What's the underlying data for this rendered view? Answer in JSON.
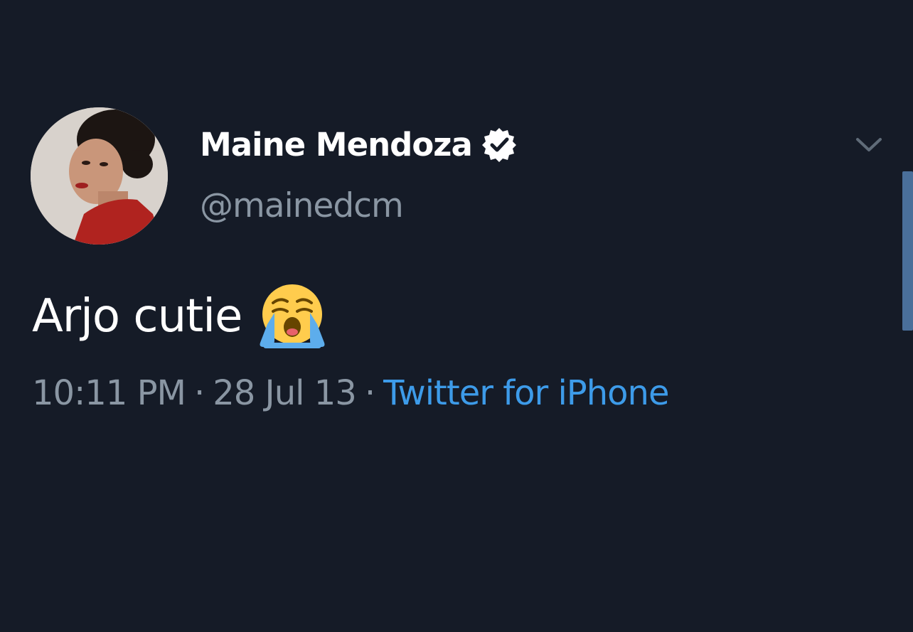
{
  "tweet": {
    "author": {
      "display_name": "Maine Mendoza",
      "handle": "@mainedcm",
      "verified": true,
      "avatar_icon": "profile-photo"
    },
    "text": "Arjo cutie",
    "emoji": "loudly-crying-face-icon",
    "time": "10:11 PM",
    "date": "28 Jul 13",
    "separator": "·",
    "source": "Twitter for iPhone"
  },
  "colors": {
    "background": "#151b27",
    "primary_text": "#ffffff",
    "secondary_text": "#8a96a3",
    "link": "#3d9be9",
    "scrollbar": "#4a6f9a"
  }
}
